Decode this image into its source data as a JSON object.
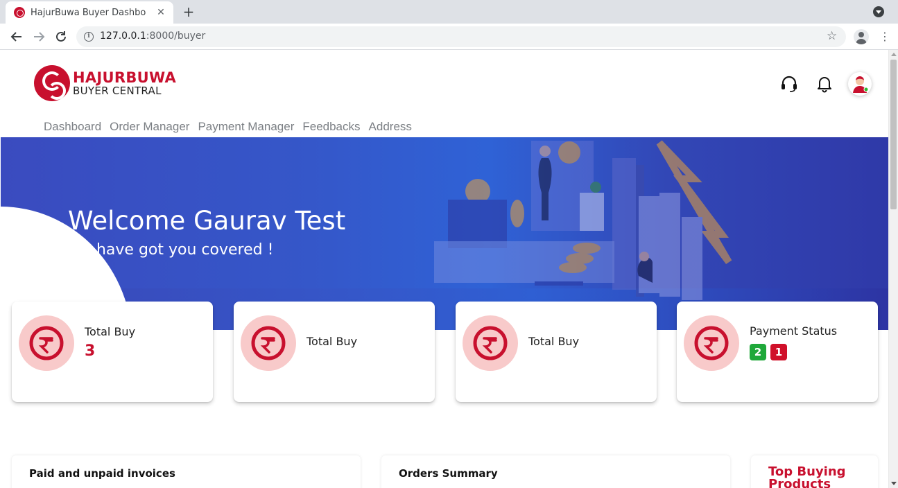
{
  "browser": {
    "tab_title": "HajurBuwa Buyer Dashbo",
    "url_host": "127.0.0.1",
    "url_path": ":8000/buyer",
    "new_tab": "+",
    "close_tab": "✕"
  },
  "brand": {
    "line1": "HAJURBUWA",
    "line2": "BUYER CENTRAL",
    "accent_color": "#c8102e"
  },
  "header_icons": [
    "headset-icon",
    "bell-icon",
    "user-avatar"
  ],
  "nav": {
    "items": [
      {
        "label": "Dashboard"
      },
      {
        "label": "Order Manager"
      },
      {
        "label": "Payment Manager"
      },
      {
        "label": "Feedbacks"
      },
      {
        "label": "Address"
      }
    ]
  },
  "hero": {
    "welcome": "Welcome Gaurav Test",
    "subtitle": "We have got you covered !"
  },
  "cards": [
    {
      "title": "Total Buy",
      "value": "3",
      "icon": "rupee-coin-icon"
    },
    {
      "title": "Total Buy",
      "icon": "rupee-coin-icon"
    },
    {
      "title": "Total Buy",
      "icon": "rupee-coin-icon"
    },
    {
      "title": "Payment Status",
      "icon": "rupee-coin-icon",
      "badges": [
        {
          "value": "2",
          "color": "#1fa83a"
        },
        {
          "value": "1",
          "color": "#d0102a"
        }
      ]
    }
  ],
  "panels": [
    {
      "title": "Paid and unpaid invoices"
    },
    {
      "title": "Orders Summary"
    },
    {
      "title": "Top Buying Products"
    }
  ]
}
